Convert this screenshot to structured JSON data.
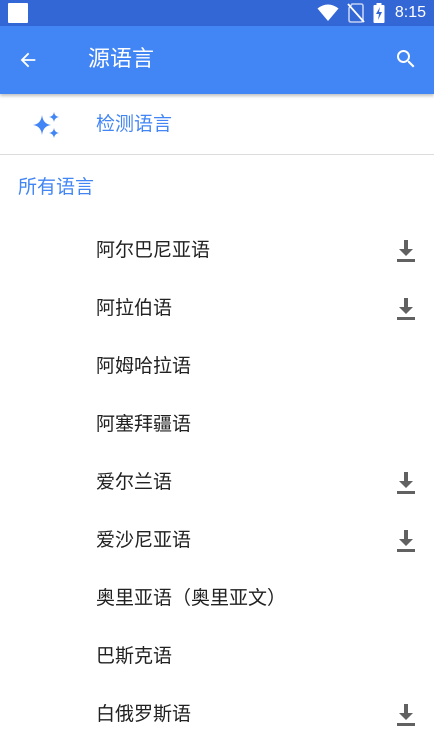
{
  "status_bar": {
    "time": "8:15",
    "icons": [
      "wifi-icon",
      "no-sim-icon",
      "battery-charging-icon"
    ]
  },
  "app_bar": {
    "title": "源语言",
    "back_icon": "arrow-back-icon",
    "search_icon": "search-icon"
  },
  "detect": {
    "label": "检测语言",
    "icon": "sparkle-icon"
  },
  "section_header": "所有语言",
  "languages": [
    {
      "label": "阿尔巴尼亚语",
      "downloadable": true
    },
    {
      "label": "阿拉伯语",
      "downloadable": true
    },
    {
      "label": "阿姆哈拉语",
      "downloadable": false
    },
    {
      "label": "阿塞拜疆语",
      "downloadable": false
    },
    {
      "label": "爱尔兰语",
      "downloadable": true
    },
    {
      "label": "爱沙尼亚语",
      "downloadable": true
    },
    {
      "label": "奥里亚语（奥里亚文）",
      "downloadable": false
    },
    {
      "label": "巴斯克语",
      "downloadable": false
    },
    {
      "label": "白俄罗斯语",
      "downloadable": true
    }
  ],
  "colors": {
    "status_bar": "#3367d6",
    "app_bar": "#4285f4",
    "accent": "#4285f4",
    "text": "#212121",
    "icon_gray": "#616161"
  }
}
